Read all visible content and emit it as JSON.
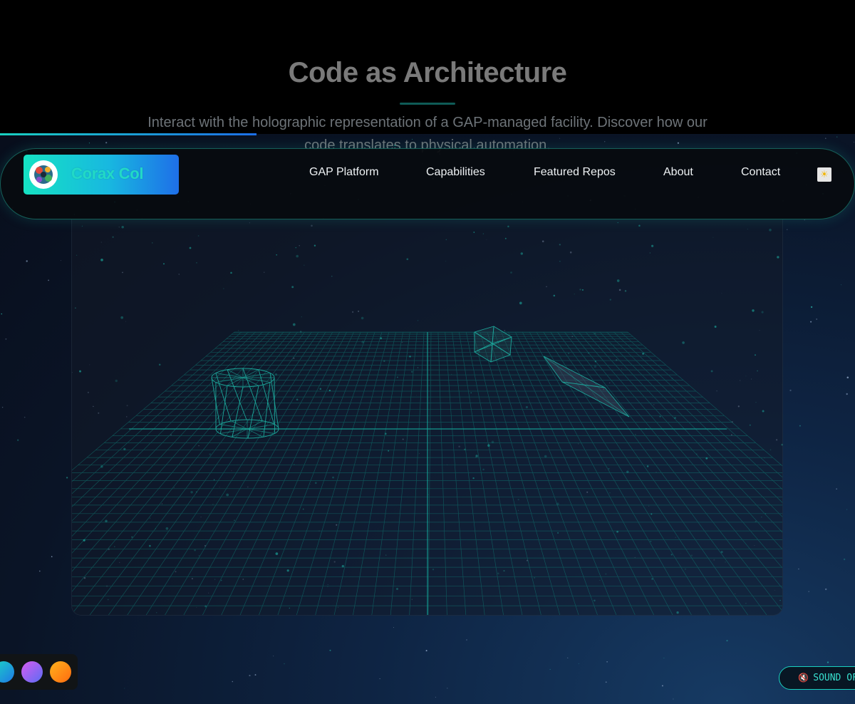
{
  "hero": {
    "title": "Code as Architecture",
    "description": "Interact with the holographic representation of a GAP-managed facility. Discover how our code translates to physical automation."
  },
  "progress": {
    "fraction": 0.3
  },
  "brand": {
    "name": "Corax Col"
  },
  "nav": {
    "links": [
      "GAP Platform",
      "Capabilities",
      "Featured Repos",
      "About",
      "Contact"
    ]
  },
  "theme_toggle": {
    "icon": "sun-icon"
  },
  "palette": {
    "swatches": [
      {
        "name": "cyan-swatch",
        "colors": [
          "#1bd3c5",
          "#1f78e6"
        ]
      },
      {
        "name": "violet-swatch",
        "colors": [
          "#d85cf0",
          "#5a6cf4"
        ]
      },
      {
        "name": "orange-swatch",
        "colors": [
          "#ffb21c",
          "#ff6b10"
        ]
      }
    ]
  },
  "sound": {
    "label": "SOUND OFF",
    "icon": "muted-speaker-icon"
  },
  "colors": {
    "accent": "#19d1c1",
    "grid": "#0f7f78"
  }
}
